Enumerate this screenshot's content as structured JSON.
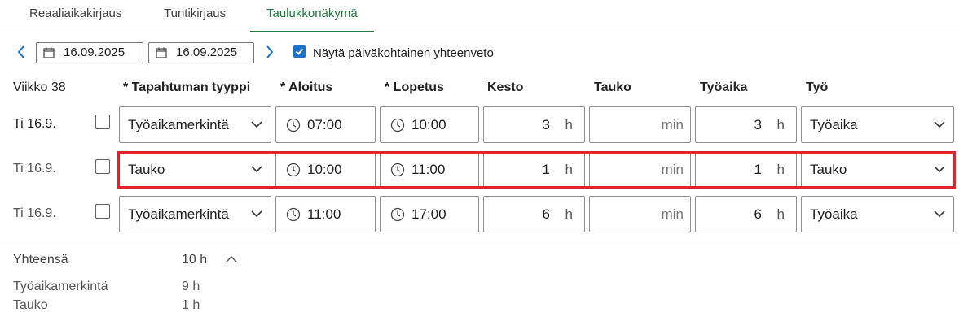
{
  "tabs": [
    {
      "label": "Reaaliaikakirjaus"
    },
    {
      "label": "Tuntikirjaus"
    },
    {
      "label": "Taulukkonäkymä"
    }
  ],
  "toolbar": {
    "start_date": "16.09.2025",
    "end_date": "16.09.2025",
    "summary_checkbox_label": "Näytä päiväkohtainen yhteenveto",
    "summary_checked": true
  },
  "header": {
    "week": "Viikko 38",
    "type": "* Tapahtuman tyyppi",
    "start": "* Aloitus",
    "end": "* Lopetus",
    "duration": "Kesto",
    "break": "Tauko",
    "worktime": "Työaika",
    "work": "Työ"
  },
  "rows": [
    {
      "date": "Ti 16.9.",
      "type": "Työaikamerkintä",
      "start": "07:00",
      "end": "10:00",
      "duration": "3",
      "duration_unit": "h",
      "break_unit": "min",
      "worktime": "3",
      "worktime_unit": "h",
      "work": "Työaika"
    },
    {
      "date": "Ti 16.9.",
      "type": "Tauko",
      "start": "10:00",
      "end": "11:00",
      "duration": "1",
      "duration_unit": "h",
      "break_unit": "min",
      "worktime": "1",
      "worktime_unit": "h",
      "work": "Tauko"
    },
    {
      "date": "Ti 16.9.",
      "type": "Työaikamerkintä",
      "start": "11:00",
      "end": "17:00",
      "duration": "6",
      "duration_unit": "h",
      "break_unit": "min",
      "worktime": "6",
      "worktime_unit": "h",
      "work": "Työaika"
    }
  ],
  "summary": {
    "total_label": "Yhteensä",
    "total_value": "10 h",
    "items": [
      {
        "label": "Työaikamerkintä",
        "value": "9 h"
      },
      {
        "label": "Tauko",
        "value": "1 h"
      }
    ]
  },
  "colors": {
    "accent": "#1f7a3e",
    "link": "#1a73c7",
    "highlight": "#e0242b"
  }
}
